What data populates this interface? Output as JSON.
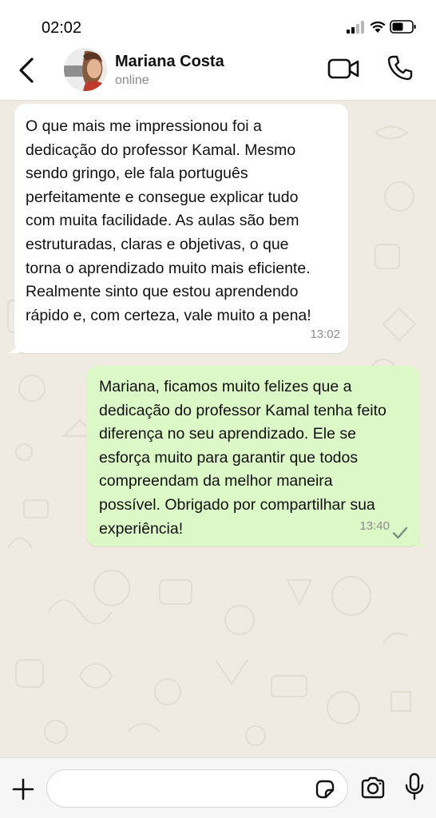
{
  "status_bar": {
    "time": "02:02",
    "icons": [
      "signal-icon",
      "wifi-icon",
      "battery-icon"
    ]
  },
  "header": {
    "contact_name": "Mariana Costa",
    "contact_status": "online",
    "icons": [
      "back-arrow-icon",
      "video-camera-icon",
      "phone-icon"
    ]
  },
  "messages": [
    {
      "direction": "incoming",
      "text": "O que mais me impressionou foi a\ndedicação do professor Kamal. Mesmo\nsendo gringo, ele fala português\nperfeitamente e consegue explicar tudo\ncom muita facilidade. As aulas são bem\nestruturadas, claras e objetivas, o que\ntorna o aprendizado muito mais eficiente.\nRealmente sinto que estou aprendendo\nrápido e, com certeza, vale muito a pena!",
      "time": "13:02"
    },
    {
      "direction": "outgoing",
      "text": "Mariana, ficamos muito felizes que a\ndedicação do professor Kamal tenha feito\ndiferença no seu aprendizado. Ele se\nesforça muito para garantir que todos\ncompreendam da melhor maneira\npossível. Obrigado por compartilhar sua\nexperiência!",
      "time": "13:40",
      "status_icon": "single-check-icon"
    }
  ],
  "input_bar": {
    "placeholder": "",
    "icons": [
      "plus-icon",
      "sticker-icon",
      "camera-icon",
      "microphone-icon"
    ]
  },
  "colors": {
    "chat_background": "#efeae2",
    "incoming_bubble": "#ffffff",
    "outgoing_bubble": "#dcf8c6",
    "header_background": "#ffffff",
    "input_bar_background": "#f6f6f6",
    "timestamp": "#8c8c8c"
  }
}
